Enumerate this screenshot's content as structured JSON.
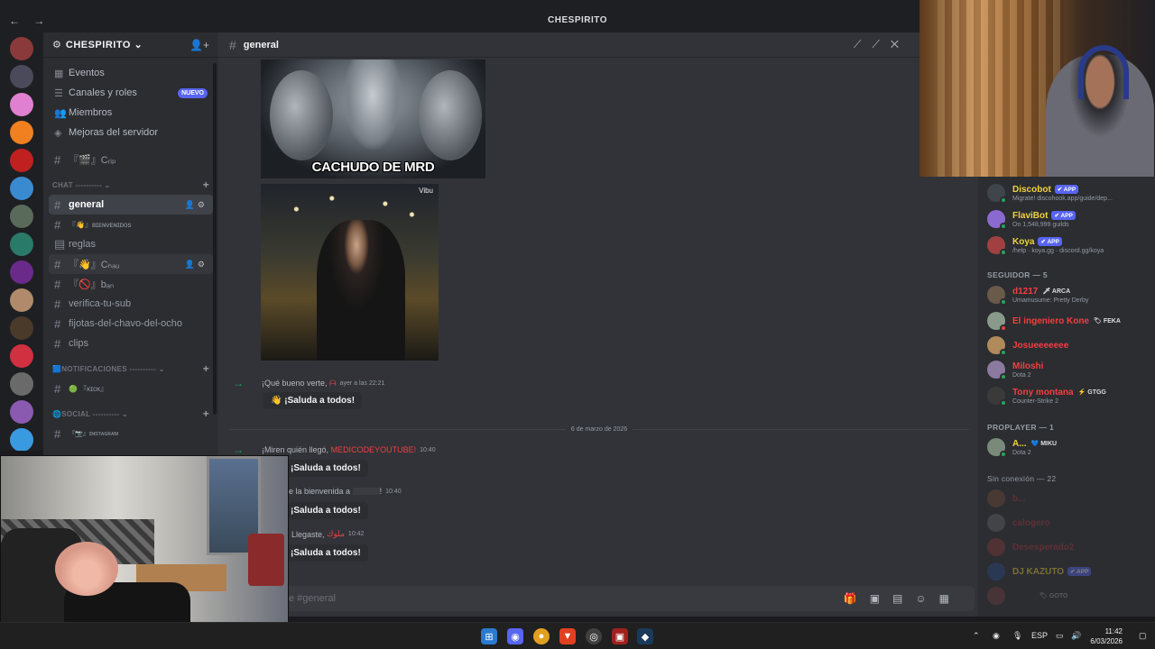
{
  "window": {
    "title": "CHESPIRITO"
  },
  "server": {
    "name": "CHESPIRITO ⌄"
  },
  "nav": [
    {
      "icon": "calendar-icon",
      "label": "Eventos"
    },
    {
      "icon": "list-icon",
      "label": "Canales y roles",
      "badge": "NUEVO"
    },
    {
      "icon": "members-icon",
      "label": "Miembros"
    },
    {
      "icon": "boost-icon",
      "label": "Mejoras del servidor"
    }
  ],
  "channels_top": [
    {
      "label": "『🎬』Cᵣᵢₚ"
    }
  ],
  "categories": {
    "chat": "CHAT ---------- ⌄",
    "notificaciones": "🟦NOTIFICACIONES ---------- ⌄",
    "social": "🌐SOCIAL ---------- ⌄"
  },
  "chat_channels": [
    {
      "label": "general",
      "active": true
    },
    {
      "label": "『👋』ʙɪᴇɴᴠᴇɴɪᴅᴏs"
    },
    {
      "label": "reglas"
    },
    {
      "label": "『👋』Cₕₐᵤ"
    },
    {
      "label": "『🚫』bₐₙ"
    },
    {
      "label": "verifica-tu-sub"
    },
    {
      "label": "fijotas-del-chavo-del-ocho"
    },
    {
      "label": "clips"
    }
  ],
  "notif_channels": [
    {
      "label": "🟢 『ᴋɪᴄᴋ』"
    }
  ],
  "social_channels": [
    {
      "label": "『📷』ɪɴsᴛᴀɢʀᴀᴍ"
    }
  ],
  "chat_header": {
    "channel": "general"
  },
  "messages": {
    "image1_caption": "CACHUDO DE MRD",
    "image2_tag": "Vibu",
    "msg1": {
      "text": "¡Qué bueno verte,",
      "user": "ᗩ",
      "time": "ayer a las 22:21",
      "button": "¡Saluda a todos!"
    },
    "date_divider": "6 de marzo de 2026",
    "msg2": {
      "text": "¡Miren quién llegó,",
      "user": "MEDICODEYOUTUBE!",
      "time": "10:40",
      "button": "¡Saluda a todos!"
    },
    "msg3": {
      "text": "le la bienvenida a",
      "user": "!",
      "time": "10:40",
      "button": "¡Saluda a todos!"
    },
    "msg4": {
      "text": ": Llegaste,",
      "user": "ملوك",
      "time": "10:42",
      "button": "¡Saluda a todos!"
    }
  },
  "composer": {
    "placeholder": "e #general"
  },
  "members": {
    "bots": [
      {
        "name": "Discobot",
        "tag": "✔ APP",
        "sub": "Migrate! discohook.app/guide/dep...",
        "color": "#f0d33a"
      },
      {
        "name": "FlaviBot",
        "tag": "✔ APP",
        "sub": "On 1,548,999 guilds",
        "color": "#f0d33a"
      },
      {
        "name": "Koya",
        "tag": "✔ APP",
        "sub": "/help · koya.gg · discord.gg/koya",
        "color": "#f0d33a"
      }
    ],
    "seguidor_header": "SEGUIDOR — 5",
    "seguidores": [
      {
        "name": "d1217",
        "tag": "🗡 ARCA",
        "sub": "Umamusume: Pretty Derby",
        "color": "#f23f42"
      },
      {
        "name": "El ingeniero Kone",
        "tag": "🏷 FEKA",
        "sub": "",
        "color": "#f23f42"
      },
      {
        "name": "Josueeeeeee",
        "tag": "",
        "sub": "",
        "color": "#f23f42"
      },
      {
        "name": "Miloshi",
        "tag": "",
        "sub": "Dota 2",
        "color": "#f23f42"
      },
      {
        "name": "Tony montana",
        "tag": "⚡ GTGG",
        "sub": "Counter-Strike 2",
        "color": "#f23f42"
      }
    ],
    "proplayer_header": "PROPLAYER — 1",
    "proplayers": [
      {
        "name": "A...",
        "tag": "💙 MIKU",
        "sub": "Dota 2",
        "color": "#f0d33a"
      }
    ],
    "offline_header": "Sin conexión — 22",
    "offline": [
      {
        "name": "b...",
        "tag": ""
      },
      {
        "name": "calogero",
        "tag": ""
      },
      {
        "name": "Desesperado2",
        "tag": ""
      },
      {
        "name": "DJ KAZUTO",
        "tag": "✔ APP"
      },
      {
        "name": "",
        "tag": "🏷 GOTO"
      }
    ]
  },
  "taskbar": {
    "lang": "ESP",
    "time": "11:42",
    "date": "6/03/2026"
  },
  "colors": {
    "accent": "#5865f2",
    "online": "#23a55a",
    "danger": "#f23f42"
  }
}
